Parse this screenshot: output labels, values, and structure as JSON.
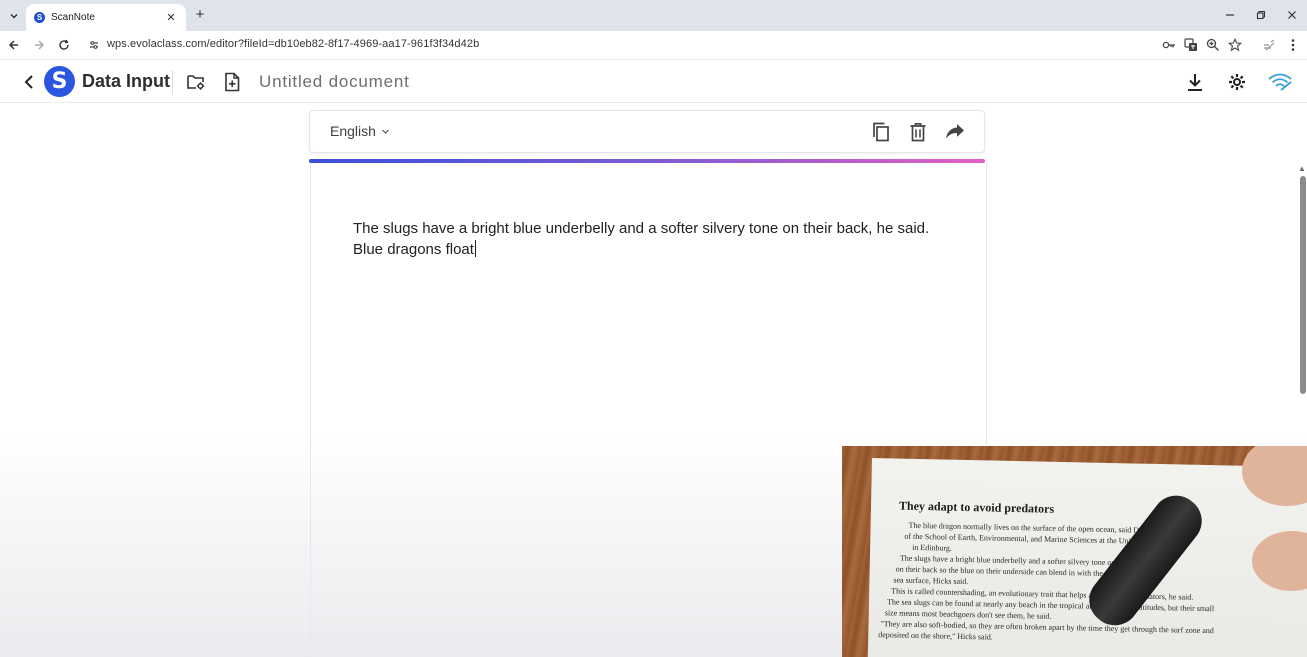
{
  "browser": {
    "tab_title": "ScanNote",
    "tab_favicon_letter": "S",
    "url": "wps.evolaclass.com/editor?fileId=db10eb82-8f17-4969-aa17-961f3f34d42b"
  },
  "app": {
    "logo_letter": "S",
    "title": "Data Input",
    "document_title": "Untitled document"
  },
  "editor": {
    "language": "English",
    "text": "The slugs have a bright blue underbelly and a softer silvery tone on their back, he said. Blue dragons float"
  },
  "camera": {
    "heading": "They adapt to avoid predators",
    "lines": [
      "The blue dragon normally lives on the surface of the open ocean, said David Hicks, pro",
      "of the School of Earth, Environmental, and Marine Sciences at the University of Te",
      "in Edinburg.",
      "The slugs have a bright blue underbelly and a softer silvery tone on their back",
      "on their back so the blue on their underside can blend in with the water while",
      "sea surface, Hicks said.",
      "This is called countershading, an evolutionary trait that helps animals avoid predators, he said.",
      "The sea slugs can be found at nearly any beach in the tropical and subtropical latitudes, but their small",
      "size means most beachgoers don't see them, he said.",
      "\"They are also soft-bodied, so they are often broken apart by the time they get through the surf zone and",
      "deposited on the shore,\" Hicks said."
    ]
  },
  "colors": {
    "brand": "#2a56e0",
    "gradient_start": "#3b4fd8",
    "gradient_end": "#e45fc4"
  }
}
